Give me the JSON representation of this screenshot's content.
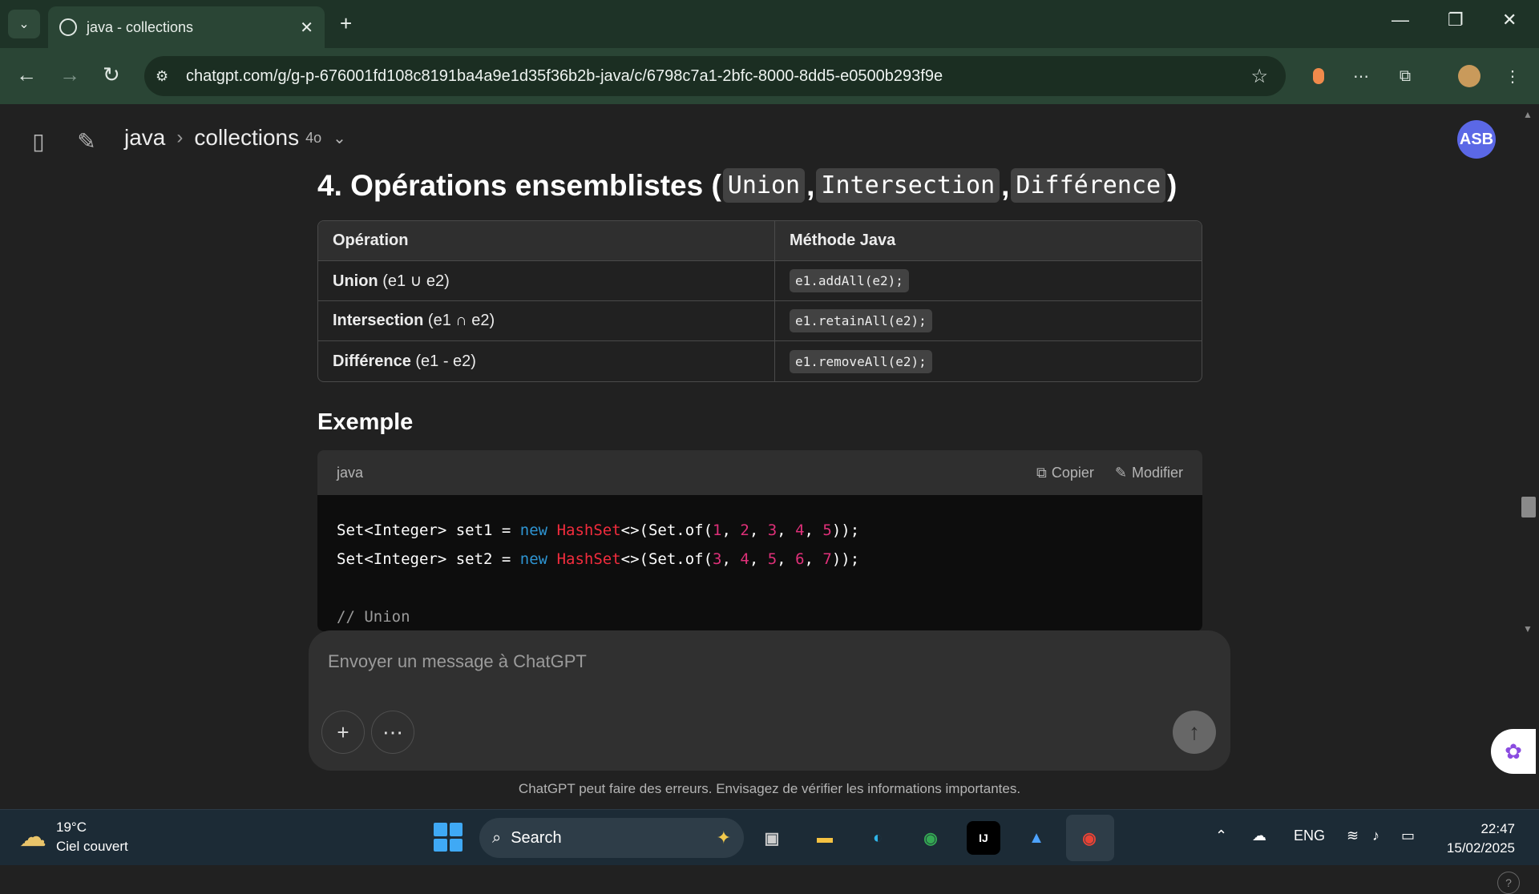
{
  "browser": {
    "tab_title": "java - collections",
    "url": "chatgpt.com/g/g-p-676001fd108c8191ba4a9e1d35f36b2b-java/c/6798c7a1-2bfc-8000-8dd5-e0500b293f9e"
  },
  "header": {
    "project": "java",
    "chat_title": "collections",
    "model": "4o",
    "avatar": "ASB"
  },
  "content": {
    "heading_prefix": "4. Opérations ensemblistes (",
    "heading_code1": "Union",
    "heading_code2": "Intersection",
    "heading_code3": "Différence",
    "heading_sep": ",",
    "heading_suffix": ")",
    "table": {
      "headers": [
        "Opération",
        "Méthode Java"
      ],
      "rows": [
        {
          "name": "Union",
          "detail": " (e1 ∪ e2)",
          "method": "e1.addAll(e2);"
        },
        {
          "name": "Intersection",
          "detail": " (e1 ∩ e2)",
          "method": "e1.retainAll(e2);"
        },
        {
          "name": "Différence",
          "detail": " (e1 - e2)",
          "method": "e1.removeAll(e2);"
        }
      ]
    },
    "example_heading": "Exemple",
    "code": {
      "language": "java",
      "copy_label": "Copier",
      "edit_label": "Modifier",
      "comment": "// Union"
    }
  },
  "composer": {
    "placeholder": "Envoyer un message à ChatGPT"
  },
  "disclaimer": "ChatGPT peut faire des erreurs. Envisagez de vérifier les informations importantes.",
  "taskbar": {
    "temperature": "19°C",
    "weather": "Ciel couvert",
    "search": "Search",
    "lang": "ENG",
    "time": "22:47",
    "date": "15/02/2025"
  }
}
